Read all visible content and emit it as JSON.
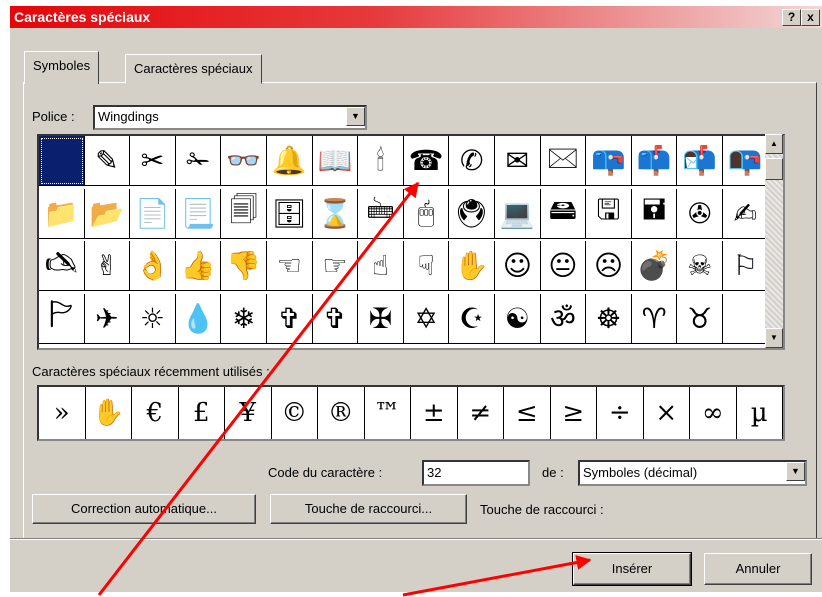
{
  "window": {
    "title": "Caractères spéciaux",
    "help_label": "?",
    "close_label": "x"
  },
  "tabs": [
    {
      "label": "Symboles",
      "active": true
    },
    {
      "label": "Caractères spéciaux",
      "active": false
    }
  ],
  "font": {
    "label": "Police :",
    "value": "Wingdings"
  },
  "grid": {
    "rows": [
      [
        "",
        "✎",
        "✂",
        "✁",
        "👓",
        "🔔",
        "📖",
        "🕯",
        "☎",
        "✆",
        "✉",
        "🖂",
        "📪",
        "📫",
        "📬",
        "📭"
      ],
      [
        "📁",
        "📂",
        "📄",
        "📃",
        "🗐",
        "🗄",
        "⌛",
        "🖮",
        "🖱",
        "🖲",
        "💻",
        "🖴",
        "🖫",
        "🖬",
        "✇",
        "✍"
      ],
      [
        "🖎",
        "✌",
        "👌",
        "👍",
        "👎",
        "☜",
        "☞",
        "☝",
        "☟",
        "✋",
        "☺",
        "😐",
        "☹",
        "💣",
        "☠",
        "⚐"
      ],
      [
        "🏱",
        "✈",
        "☼",
        "💧",
        "❄",
        "✞",
        "✞",
        "✠",
        "✡",
        "☪",
        "☯",
        "ॐ",
        "☸",
        "♈",
        "♉",
        ""
      ]
    ],
    "selected": [
      0,
      0
    ]
  },
  "recent": {
    "label": "Caractères spéciaux récemment utilisés :",
    "chars": [
      "»",
      "✋",
      "€",
      "£",
      "¥",
      "©",
      "®",
      "™",
      "±",
      "≠",
      "≤",
      "≥",
      "÷",
      "×",
      "∞",
      "µ"
    ]
  },
  "code": {
    "label": "Code du caractère :",
    "value": "32"
  },
  "de": {
    "label": "de :",
    "value": "Symboles (décimal)"
  },
  "buttons": {
    "autocorrect": "Correction automatique...",
    "shortcut": "Touche de raccourci...",
    "shortcut_label": "Touche de raccourci :",
    "insert": "Insérer",
    "cancel": "Annuler"
  },
  "annotation_color": "#ff0000"
}
